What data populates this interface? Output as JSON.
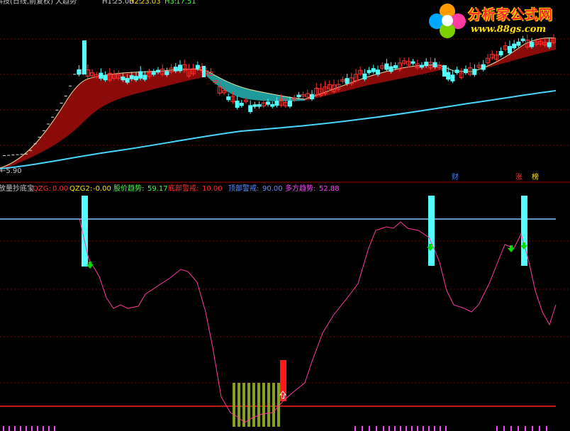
{
  "header": {
    "title": "科技(日线,前复权) 大趋势",
    "h1_label": "H1:",
    "h1_value": "25.03",
    "h2_label": "H2:",
    "h2_value": "23.03",
    "h3_label": "H3:",
    "h3_value": "17.51"
  },
  "main_chart": {
    "low_price_label": "5.90",
    "markers": [
      "财",
      "涨",
      "榜"
    ]
  },
  "indicator": {
    "name": "放量抄底宝",
    "qzg_label": "QZG:",
    "qzg_value": "0.00",
    "qzg2_label": "QZG2:",
    "qzg2_value": "-0.00",
    "trend_label": "股价趋势:",
    "trend_value": "59.17",
    "bottom_label": "底部警戒:",
    "bottom_value": "10.00",
    "top_label": "顶部警戒:",
    "top_value": "90.00",
    "bull_label": "多方趋势:",
    "bull_value": "52.88"
  },
  "logo": {
    "title": "分析家公式网",
    "url": "www.88gs.com"
  },
  "colors": {
    "background": "#000000",
    "up_candle": "#ff3030",
    "down_candle": "#54ffff",
    "ribbon_fill": "#8b0a0a",
    "ribbon_fill_alt": "#1e9a9a",
    "long_ma": "#48d8ff",
    "indicator_line": "#ff3aa0",
    "top_line": "#80c8ff",
    "bottom_line": "#ff2020",
    "volume_bar": "#88a020",
    "signal_bar": "#54ffff",
    "arrow_green": "#00dd00"
  }
}
